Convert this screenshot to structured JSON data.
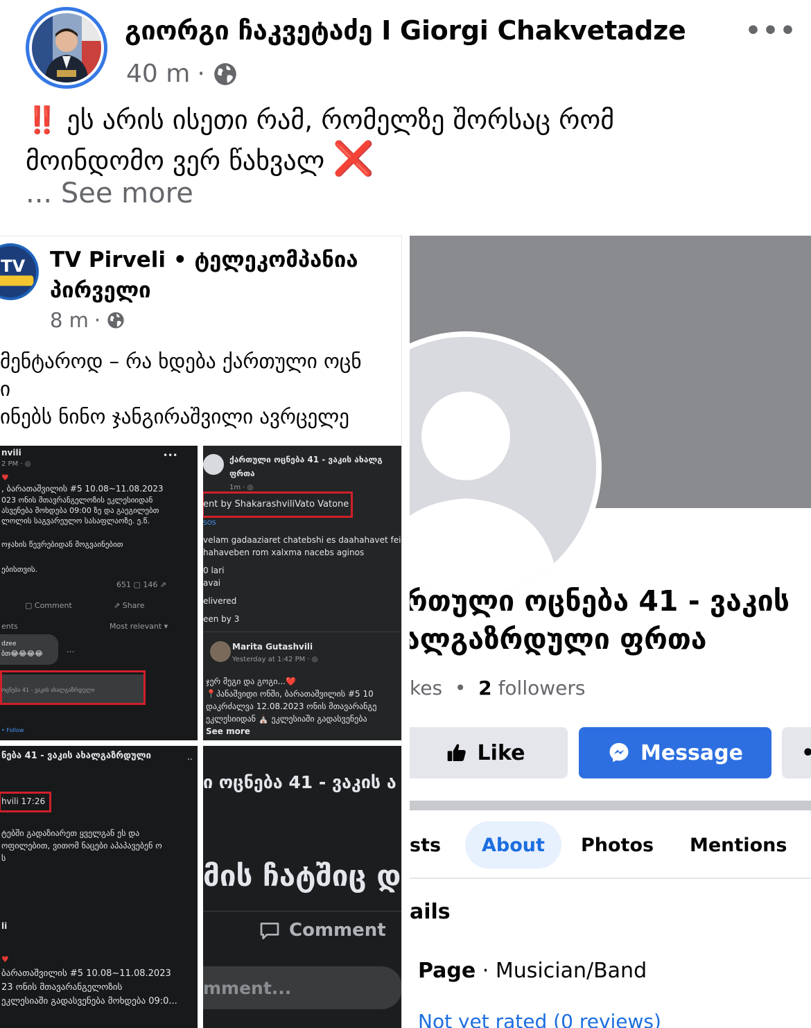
{
  "post": {
    "author": "გიორგი ჩაკვეტაძე I Giorgi Chakvetadze",
    "time": "40 m",
    "dot": "·",
    "more": "•••",
    "emoji_prefix": "‼️",
    "text_line1": "ეს არის ისეთი რამ, რომელზე შორსაც რომ",
    "text_line2": "მოინდომო ვერ წახვალ",
    "emoji_suffix": "❌",
    "see_more": "... See more"
  },
  "shared_post": {
    "page_name": "TV Pirveli • ტელეკომპანია პირველი",
    "time": "8 m",
    "dot": "·",
    "text_line1": "მენტაროდ – რა ხდება ქართული ოცნ",
    "text_line2": "ი",
    "text_line3": "ინებს ნინო ჯანგირაშვილი ავრცელე",
    "cell1": {
      "name": "nvili",
      "time": "2 PM · ◎",
      "l1": ", ბარათაშვილის #5 10.08~11.08.2023",
      "l2": "023 ონის მთავრანგელოზის ეკლესიიდან",
      "l3": "ასვენება მოხდება 09:00 ზე და გაეგილებთ",
      "l4": "ლოლის საგვარეულო სასაფლაოზე. ე.წ.",
      "l5": "ოჯახის წევრებიდან მოგვაინებით",
      "l6": "ებისთვის.",
      "counts": "651 ▢   146 ⇗",
      "comment": "Comment",
      "share": "Share",
      "ents": "ents",
      "relevant": "Most relevant ▾",
      "dzee": "dzee",
      "emoji": "ბთ😂😂😂😂",
      "dots": "...",
      "boxed": "ოცნება 41 - ვაკის ახალგაზრდული",
      "follow": "• Follow"
    },
    "cell2": {
      "title": "ქართული ოცნება 41 - ვაკის ახალგ",
      "sub": "ფრთა",
      "time": "1m · ◎",
      "boxed": "ent by ShakarashviliVato Vatone",
      "sos": "SOS",
      "l1": "velam gadaaziaret chatebshi es daahahavet fei",
      "l2": "hahaveben rom xalxma nacebs aginos",
      "l3": "0 lari",
      "l4": "avai",
      "l5": "elivered",
      "l6": "een by 3",
      "name2": "Marita Gutashvili",
      "time2": "Yesterday at 1:42 PM · ◎",
      "m1": "ჯერ მეგი და გოგი...❤️",
      "m2": "📍პანაშვიდი ონში, ბარათაშვილის #5 10",
      "m3": "დაკრძალვა 12.08.2023 ონის მთავარანგე",
      "m4": "ეკლესიიდან ⛪ ეკლესიაში გადასვენება",
      "see_more": "See more"
    },
    "cell3": {
      "title": "ნება 41 - ვაკის ახალგაზრდული",
      "dots": "..",
      "boxed": "hvili 17:26",
      "l1": "ტებში გადაზიარეთ ყველგან ეს და",
      "l2": "ოფილებით, ვითომ ნაცები აპაპავებენ ო",
      "l3": "ს",
      "li": "li",
      "heart": "❤️",
      "l4": "ბარათაშვილის #5 10.08~11.08.2023",
      "l5": "23 ონის მთავარანგელოზის",
      "l6": "ეკლესიაში გადასვენება მოხდება 09:0..."
    },
    "cell4": {
      "title": "ი ოცნება 41 - ვაკის ა",
      "big": "მის ჩატშიც დ",
      "comment": "Comment",
      "placeholder": "mment..."
    }
  },
  "profile": {
    "page_name_line1": "რთული ოცნება 41 - ვაკის",
    "page_name_line2": "ალგაზრდული ფრთა",
    "likes_fragment": "kes",
    "dot": "•",
    "followers_count": "2",
    "followers_label": "followers",
    "like": "Like",
    "message": "Message",
    "more": "•",
    "tabs": [
      "sts",
      "About",
      "Photos",
      "Mentions"
    ],
    "details": "ails",
    "category_label": "Page",
    "category_sep": "·",
    "category": "Musician/Band",
    "rating": "Not yet rated (0 reviews)"
  },
  "colors": {
    "accent": "#1b6ee0",
    "message_button": "#2d6fe0",
    "secondary_text": "#65676b",
    "alert_red": "#d0202a",
    "cover_grey": "#8a8b8f"
  }
}
